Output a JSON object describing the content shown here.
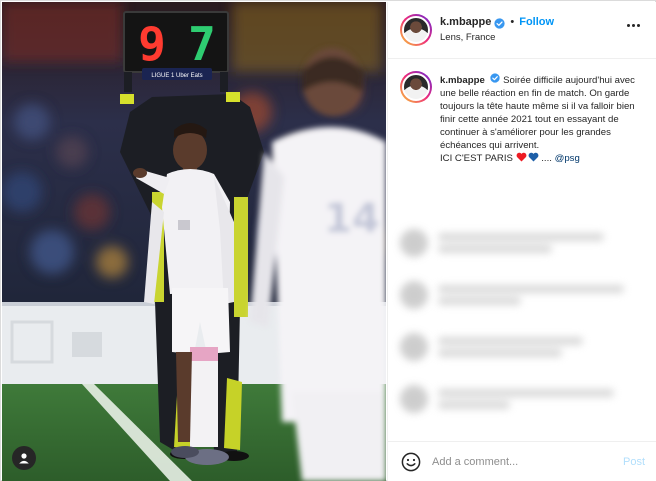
{
  "header": {
    "username": "k.mbappe",
    "separator": "•",
    "follow_label": "Follow",
    "location": "Lens, France"
  },
  "caption": {
    "username": "k.mbappe",
    "text": "Soirée difficile aujourd'hui avec une belle réaction en fin de match. On garde toujours la tête haute même si il va falloir bien finir cette année 2021 tout en essayant de continuer à s'améliorer pour les grandes échéances qui arrivent.",
    "line2": "ICI C'EST PARIS",
    "ellipsis": "....",
    "mention": "@psg"
  },
  "photo": {
    "board_digit_left": "9",
    "board_digit_right": "7",
    "board_label": "LIGUE 1 Uber Eats",
    "shirt_number": "14"
  },
  "comment": {
    "placeholder": "Add a comment...",
    "post_label": "Post"
  },
  "colors": {
    "accent": "#0095f6",
    "verified": "#3897f0",
    "heart_red": "#ed1c24",
    "heart_blue": "#1d5fa8",
    "board_red": "#ff3b30",
    "board_green": "#2ecc71"
  },
  "icons": [
    "verified-badge-icon",
    "more-options-icon",
    "user-tag-icon",
    "emoji-icon",
    "red-heart-icon",
    "blue-heart-icon"
  ]
}
